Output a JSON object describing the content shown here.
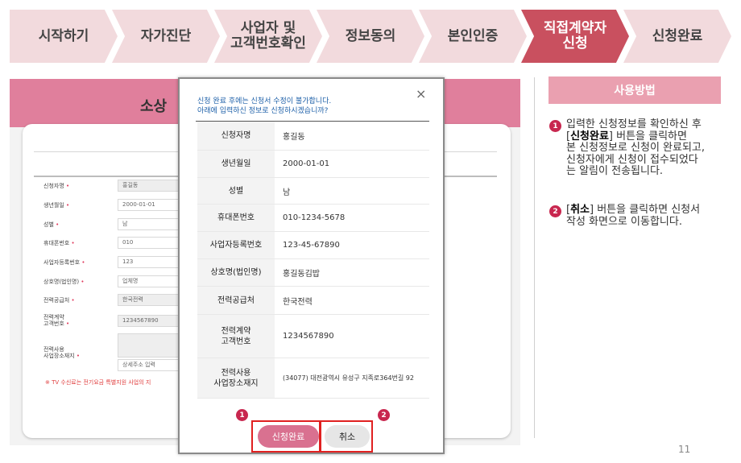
{
  "steps": [
    {
      "line1": "시작하기",
      "line2": ""
    },
    {
      "line1": "자가진단",
      "line2": ""
    },
    {
      "line1": "사업자 및",
      "line2": "고객번호확인"
    },
    {
      "line1": "정보동의",
      "line2": ""
    },
    {
      "line1": "본인인증",
      "line2": ""
    },
    {
      "line1": "직접계약자",
      "line2": "신청"
    },
    {
      "line1": "신청완료",
      "line2": ""
    }
  ],
  "background_form": {
    "title_partial": "소상",
    "rows": [
      {
        "label": "신청자명",
        "value": "홍길동"
      },
      {
        "label": "생년월일",
        "value": "2000-01-01"
      },
      {
        "label": "성별",
        "value": "남"
      },
      {
        "label": "휴대폰번호",
        "value": "010"
      },
      {
        "label": "사업자등록번호",
        "value": "123"
      },
      {
        "label": "상호명(법인명)",
        "value": "업체명"
      },
      {
        "label": "전력공급처",
        "value": "한국전력"
      },
      {
        "label_line1": "전력계약",
        "label_line2": "고객번호",
        "value": "1234567890"
      },
      {
        "label_line1": "전력사용",
        "label_line2": "사업장소재지",
        "value": "상세주소 입력"
      }
    ],
    "note": "※ TV 수신료는 전기요금 특별지원 사업의 지"
  },
  "modal": {
    "notice_line1": "신청 완료 후에는 신청서 수정이 불가합니다.",
    "notice_line2": "아래에 입력하신 정보로 신청하시겠습니까?",
    "close_icon": "×",
    "rows": [
      {
        "label": "신청자명",
        "value": "홍길동"
      },
      {
        "label": "생년월일",
        "value": "2000-01-01"
      },
      {
        "label": "성별",
        "value": "남"
      },
      {
        "label": "휴대폰번호",
        "value": "010-1234-5678"
      },
      {
        "label": "사업자등록번호",
        "value": "123-45-67890"
      },
      {
        "label": "상호명(법인명)",
        "value": "홍길동김밥"
      },
      {
        "label": "전력공급처",
        "value": "한국전력"
      },
      {
        "label_line1": "전력계약",
        "label_line2": "고객번호",
        "value": "1234567890"
      },
      {
        "label_line1": "전력사용",
        "label_line2": "사업장소재지",
        "value": "(34077) 대전광역시 유성구 지족로364번길 92"
      }
    ],
    "submit_label": "신청완료",
    "cancel_label": "취소",
    "badge_1": "1",
    "badge_2": "2"
  },
  "guide": {
    "title": "사용방법",
    "items": [
      {
        "badge": "1",
        "line1": "입력한 신청정보를 확인하신 후",
        "bracket_open": "[",
        "bold": "신청완료",
        "bracket_close": "] 버튼을 클릭하면",
        "line3": "본 신청정보로 신청이 완료되고,",
        "line4": "신청자에게 신청이 접수되었다",
        "line5": "는 알림이 전송됩니다."
      },
      {
        "badge": "2",
        "bracket_open": "[",
        "bold": "취소",
        "bracket_close": "] 버튼을 클릭하면 신청서",
        "line2": "작성 화면으로 이동합니다."
      }
    ]
  },
  "page_number": "11",
  "colors": {
    "active_step": "#c9505f",
    "step": "#f2dadd",
    "accent_pink": "#d97190",
    "badge": "#c8274f",
    "highlight": "#e02020",
    "notice": "#1c5fa8"
  }
}
